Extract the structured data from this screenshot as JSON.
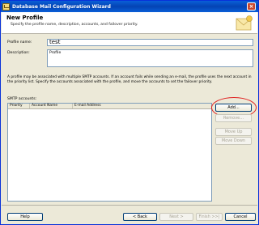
{
  "window": {
    "title": "Database Mail Configuration Wizard"
  },
  "header": {
    "title": "New Profile",
    "subtitle": "Specify the profile name, description, accounts, and failover priority."
  },
  "form": {
    "profile_name_label": "Profile name:",
    "profile_name_value": "test",
    "description_label": "Description:",
    "description_value": "Profile"
  },
  "info_text": "A profile may be associated with multiple SMTP accounts. If an account fails while sending an e-mail, the profile uses the next account in the priority list. Specify the accounts associated with the profile, and move the accounts to set the failover priority.",
  "smtp": {
    "label": "SMTP accounts:",
    "columns": [
      "Priority",
      "Account Name",
      "E-mail Address"
    ],
    "rows": []
  },
  "side_buttons": {
    "add": "Add...",
    "remove": "Remove...",
    "move_up": "Move Up",
    "move_down": "Move Down"
  },
  "footer": {
    "help": "Help",
    "back": "< Back",
    "next": "Next >",
    "finish": "Finish >>|",
    "cancel": "Cancel"
  },
  "colors": {
    "titlebar": "#0a5fd8",
    "highlight": "#e02020",
    "dialog_bg": "#ece9d8"
  }
}
